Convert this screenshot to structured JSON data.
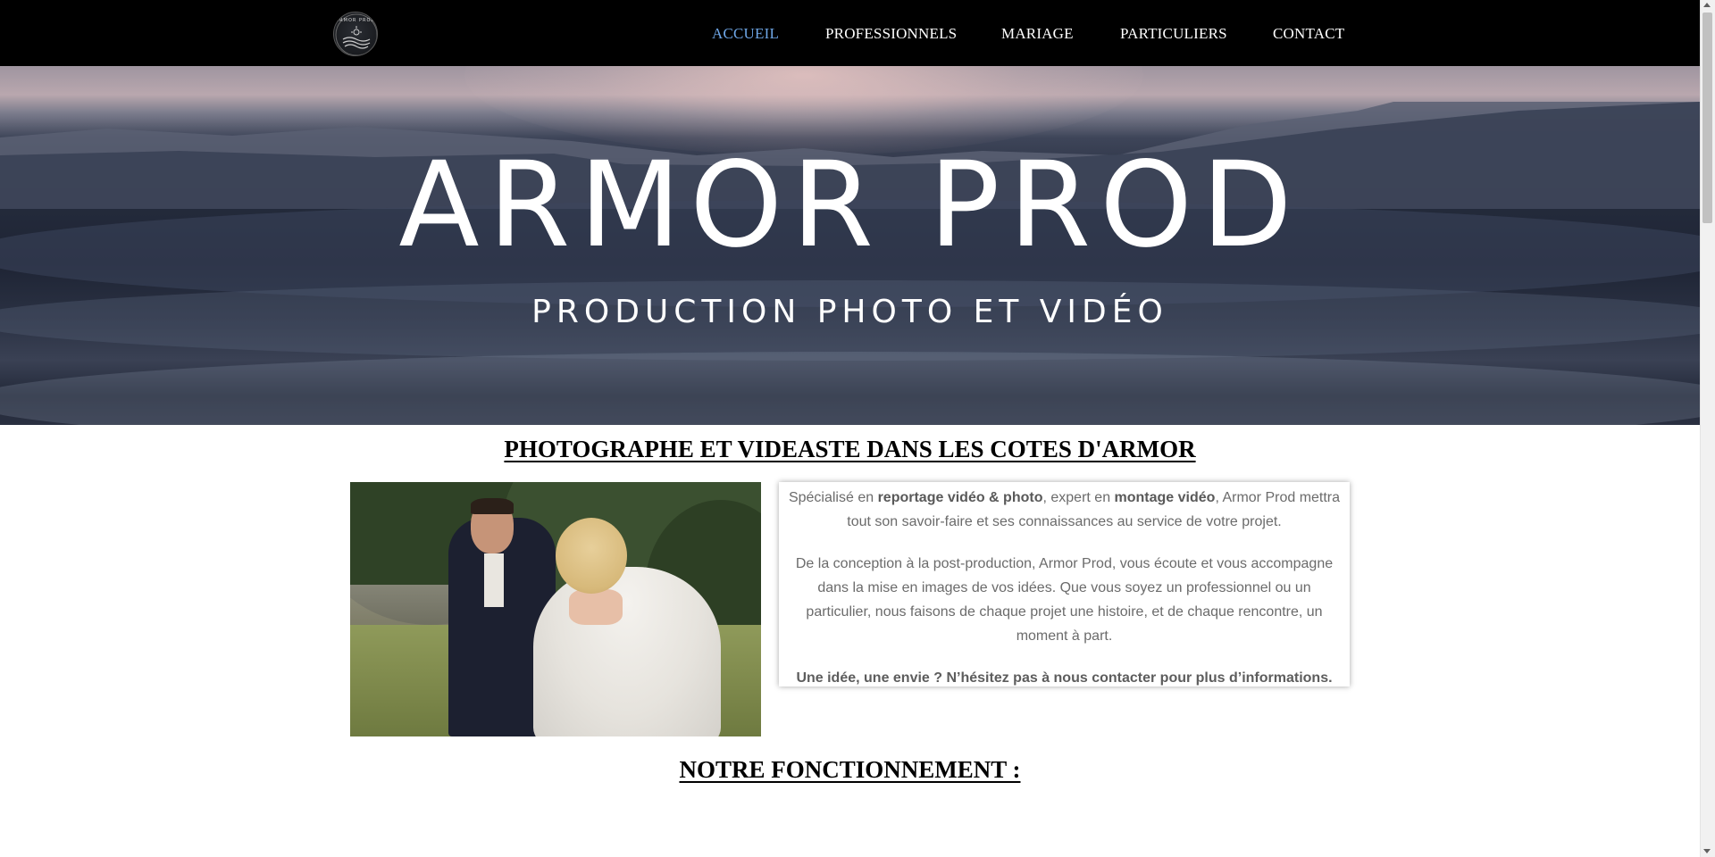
{
  "header": {
    "logo_text": "ARMOR PROD",
    "nav": [
      {
        "label": "ACCUEIL",
        "active": true
      },
      {
        "label": "PROFESSIONNELS",
        "active": false
      },
      {
        "label": "MARIAGE",
        "active": false
      },
      {
        "label": "PARTICULIERS",
        "active": false
      },
      {
        "label": "CONTACT",
        "active": false
      }
    ],
    "active_color": "#6ea6e6"
  },
  "hero": {
    "title": "ARMOR PROD",
    "subtitle": "PRODUCTION PHOTO ET VIDÉO"
  },
  "intro": {
    "heading": "PHOTOGRAPHE ET VIDEASTE DANS LES COTES D'ARMOR",
    "paragraph1": {
      "t1": "Spécialisé en ",
      "b1": "reportage vidéo & photo",
      "t2": ", expert en ",
      "b2": "montage vidéo",
      "t3": ", Armor Prod mettra tout son savoir-faire et ses connaissances au service de votre projet."
    },
    "paragraph2": "De la conception à la post-production, Armor Prod, vous écoute et vous accompagne dans la mise en images de vos idées. Que vous soyez un professionnel ou un particulier, nous faisons de chaque projet une histoire, et de chaque rencontre, un moment à part.",
    "paragraph3": "Une idée, une envie ? N’hésitez pas à nous contacter pour plus d’informations."
  },
  "section2": {
    "heading": "NOTRE FONCTIONNEMENT :"
  }
}
